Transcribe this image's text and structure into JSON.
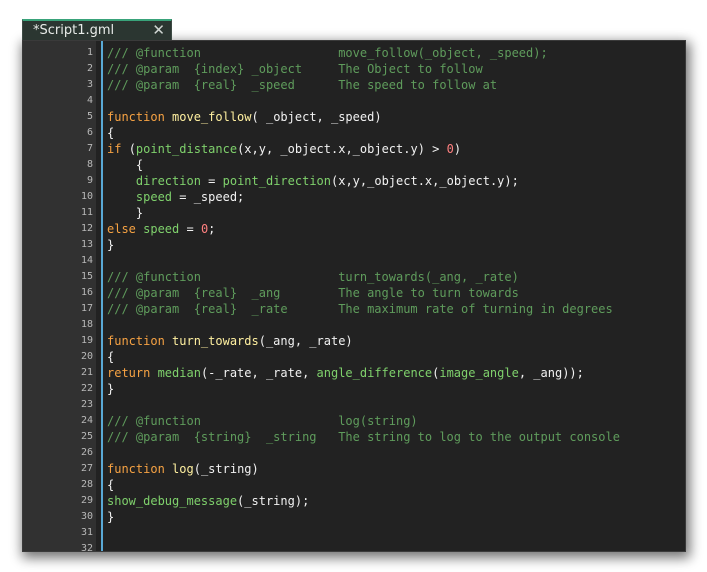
{
  "tab": {
    "title": "*Script1.gml",
    "close_glyph": "✕"
  },
  "editor": {
    "lines": [
      {
        "n": "1",
        "t": [
          [
            "cm",
            "/// @function                   move_follow(_object, _speed);"
          ]
        ]
      },
      {
        "n": "2",
        "t": [
          [
            "cm",
            "/// @param  {index} _object     The Object to follow"
          ]
        ]
      },
      {
        "n": "3",
        "t": [
          [
            "cm",
            "/// @param  {real}  _speed      The speed to follow at"
          ]
        ]
      },
      {
        "n": "4",
        "t": []
      },
      {
        "n": "5",
        "t": [
          [
            "kw",
            "function "
          ],
          [
            "fn",
            "move_follow"
          ],
          [
            "pl",
            "( _object, _speed)"
          ]
        ]
      },
      {
        "n": "6",
        "t": [
          [
            "pl",
            "{"
          ]
        ]
      },
      {
        "n": "7",
        "t": [
          [
            "kw",
            "if "
          ],
          [
            "pl",
            "("
          ],
          [
            "bi",
            "point_distance"
          ],
          [
            "pl",
            "(x,y, _object.x,_object.y) > "
          ],
          [
            "nm",
            "0"
          ],
          [
            "pl",
            ")"
          ]
        ]
      },
      {
        "n": "8",
        "t": [
          [
            "pl",
            "    {"
          ]
        ]
      },
      {
        "n": "9",
        "t": [
          [
            "pl",
            "    "
          ],
          [
            "bi",
            "direction"
          ],
          [
            "pl",
            " = "
          ],
          [
            "bi",
            "point_direction"
          ],
          [
            "pl",
            "(x,y,_object.x,_object.y);"
          ]
        ]
      },
      {
        "n": "10",
        "t": [
          [
            "pl",
            "    "
          ],
          [
            "bi",
            "speed"
          ],
          [
            "pl",
            " = _speed;"
          ]
        ]
      },
      {
        "n": "11",
        "t": [
          [
            "pl",
            "    }"
          ]
        ]
      },
      {
        "n": "12",
        "t": [
          [
            "kw",
            "else "
          ],
          [
            "bi",
            "speed"
          ],
          [
            "pl",
            " = "
          ],
          [
            "nm",
            "0"
          ],
          [
            "pl",
            ";"
          ]
        ]
      },
      {
        "n": "13",
        "t": [
          [
            "pl",
            "}"
          ]
        ]
      },
      {
        "n": "14",
        "t": []
      },
      {
        "n": "15",
        "t": [
          [
            "cm",
            "/// @function                   turn_towards(_ang, _rate)"
          ]
        ]
      },
      {
        "n": "16",
        "t": [
          [
            "cm",
            "/// @param  {real}  _ang        The angle to turn towards"
          ]
        ]
      },
      {
        "n": "17",
        "t": [
          [
            "cm",
            "/// @param  {real}  _rate       The maximum rate of turning in degrees"
          ]
        ]
      },
      {
        "n": "18",
        "t": []
      },
      {
        "n": "19",
        "t": [
          [
            "kw",
            "function "
          ],
          [
            "fn",
            "turn_towards"
          ],
          [
            "pl",
            "(_ang, _rate)"
          ]
        ]
      },
      {
        "n": "20",
        "t": [
          [
            "pl",
            "{"
          ]
        ]
      },
      {
        "n": "21",
        "t": [
          [
            "kw",
            "return "
          ],
          [
            "bi",
            "median"
          ],
          [
            "pl",
            "(-_rate, _rate, "
          ],
          [
            "bi",
            "angle_difference"
          ],
          [
            "pl",
            "("
          ],
          [
            "bi",
            "image_angle"
          ],
          [
            "pl",
            ", _ang));"
          ]
        ]
      },
      {
        "n": "22",
        "t": [
          [
            "pl",
            "}"
          ]
        ]
      },
      {
        "n": "23",
        "t": []
      },
      {
        "n": "24",
        "t": [
          [
            "cm",
            "/// @function                   log(string)"
          ]
        ]
      },
      {
        "n": "25",
        "t": [
          [
            "cm",
            "/// @param  {string}  _string   The string to log to the output console"
          ]
        ]
      },
      {
        "n": "26",
        "t": []
      },
      {
        "n": "27",
        "t": [
          [
            "kw",
            "function "
          ],
          [
            "fn",
            "log"
          ],
          [
            "pl",
            "(_string)"
          ]
        ]
      },
      {
        "n": "28",
        "t": [
          [
            "pl",
            "{"
          ]
        ]
      },
      {
        "n": "29",
        "t": [
          [
            "bi",
            "show_debug_message"
          ],
          [
            "pl",
            "(_string);"
          ]
        ]
      },
      {
        "n": "30",
        "t": [
          [
            "pl",
            "}"
          ]
        ]
      },
      {
        "n": "31",
        "t": []
      },
      {
        "n": "32",
        "t": []
      }
    ]
  },
  "colors": {
    "comment": "#5f9c5c",
    "keyword": "#f6a243",
    "function_name": "#fff0a0",
    "builtin": "#7fd16c",
    "number": "#ff8080",
    "plain": "#f2f2f2",
    "tab_accent": "#39a37a",
    "gutter_bar": "#5aa9d6"
  }
}
